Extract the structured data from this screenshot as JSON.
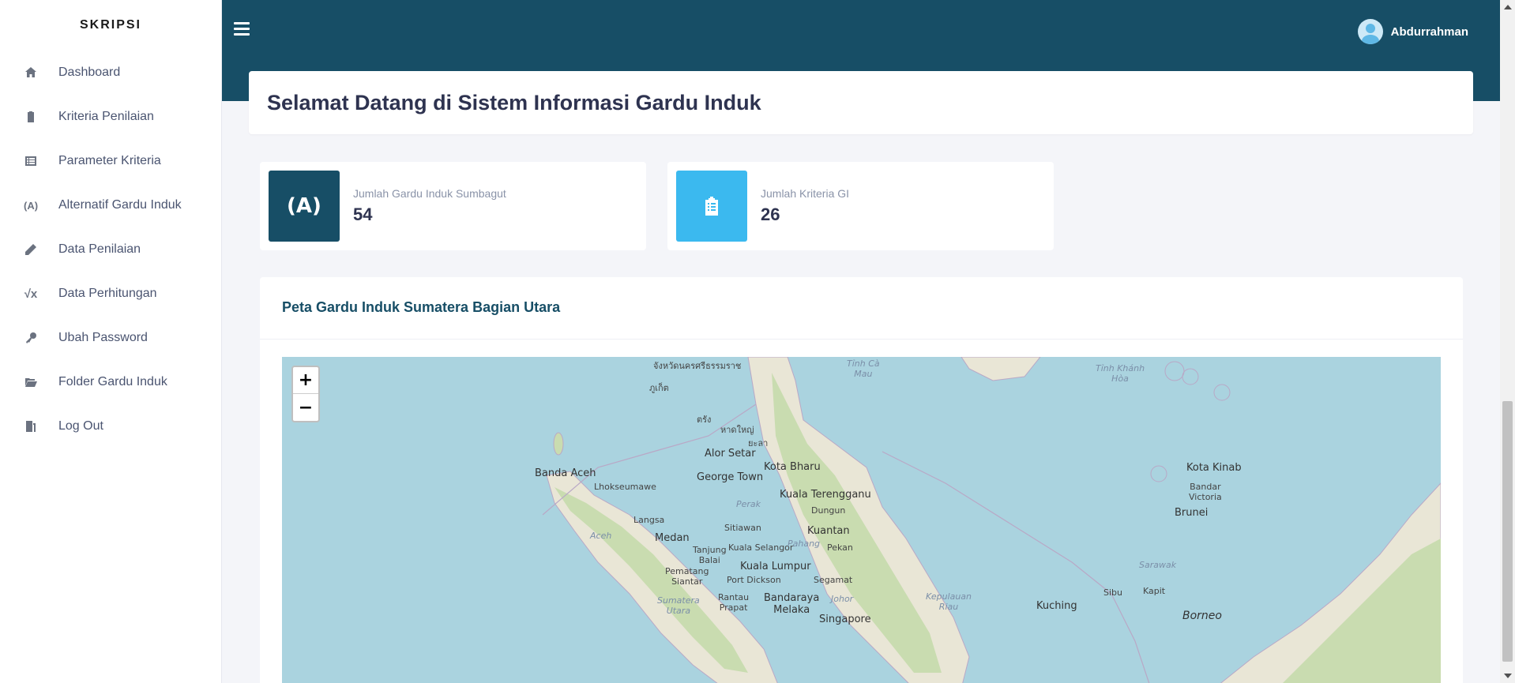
{
  "brand": "SKRIPSI",
  "sidebar": {
    "items": [
      {
        "label": "Dashboard",
        "icon": "home-icon"
      },
      {
        "label": "Kriteria Penilaian",
        "icon": "clipboard-icon"
      },
      {
        "label": "Parameter Kriteria",
        "icon": "list-icon"
      },
      {
        "label": "Alternatif Gardu Induk",
        "icon": "broadcast-tower-icon"
      },
      {
        "label": "Data Penilaian",
        "icon": "pencil-icon"
      },
      {
        "label": "Data Perhitungan",
        "icon": "square-root-icon"
      },
      {
        "label": "Ubah Password",
        "icon": "key-icon"
      },
      {
        "label": "Folder Gardu Induk",
        "icon": "folder-open-icon"
      },
      {
        "label": "Log Out",
        "icon": "door-exit-icon"
      }
    ]
  },
  "topbar": {
    "user_name": "Abdurrahman"
  },
  "welcome": {
    "title": "Selamat Datang di Sistem Informasi Gardu Induk"
  },
  "stats": [
    {
      "label": "Jumlah Gardu Induk Sumbagut",
      "value": "54",
      "color": "#174e66",
      "icon": "broadcast-tower-icon"
    },
    {
      "label": "Jumlah Kriteria GI",
      "value": "26",
      "color": "#3bb9ef",
      "icon": "clipboard-list-icon"
    }
  ],
  "map_card": {
    "title": "Peta Gardu Induk Sumatera Bagian Utara",
    "zoom_in": "+",
    "zoom_out": "−",
    "labels": {
      "banda_aceh": "Banda Aceh",
      "lhokseumawe": "Lhokseumawe",
      "langsa": "Langsa",
      "aceh": "Aceh",
      "medan": "Medan",
      "tanjung_balai": "Tanjung\nBalai",
      "pematang_siantar": "Pematang\nSiantar",
      "rantau_prapat": "Rantau\nPrapat",
      "sumatera_utara": "Sumatera\nUtara",
      "alor_setar": "Alor Setar",
      "george_town": "George Town",
      "kota_bharu": "Kota Bharu",
      "kuala_terengganu": "Kuala Terengganu",
      "dungun": "Dungun",
      "kuantan": "Kuantan",
      "pekan": "Pekan",
      "kuala_lumpur": "Kuala Lumpur",
      "kuala_selangor": "Kuala Selangor",
      "pahang": "Pahang",
      "perak": "Perak",
      "sitiawan": "Sitiawan",
      "port_dickson": "Port Dickson",
      "segamat": "Segamat",
      "bandaraya_melaka": "Bandaraya\nMelaka",
      "johor": "Johor",
      "singapore": "Singapore",
      "kepulauan_riau": "Kepulauan\nRiau",
      "kuching": "Kuching",
      "sibu": "Sibu",
      "kapit": "Kapit",
      "sarawak": "Sarawak",
      "brunei": "Brunei",
      "kota_kinabalu": "Kota Kinab",
      "bandar_victoria": "Bandar\nVictoria",
      "borneo": "Borneo",
      "tinh_ca_mau": "Tỉnh Cà\nMau",
      "tinh_khanh_hoa": "Tỉnh Khánh\nHòa",
      "phuket": "ภูเก็ต",
      "trang": "ตรัง",
      "hat_yai": "หาดใหญ่",
      "yala": "ยะลา",
      "nakhon_si_thammarat": "จังหวัดนครศรีธรรมราช"
    }
  }
}
